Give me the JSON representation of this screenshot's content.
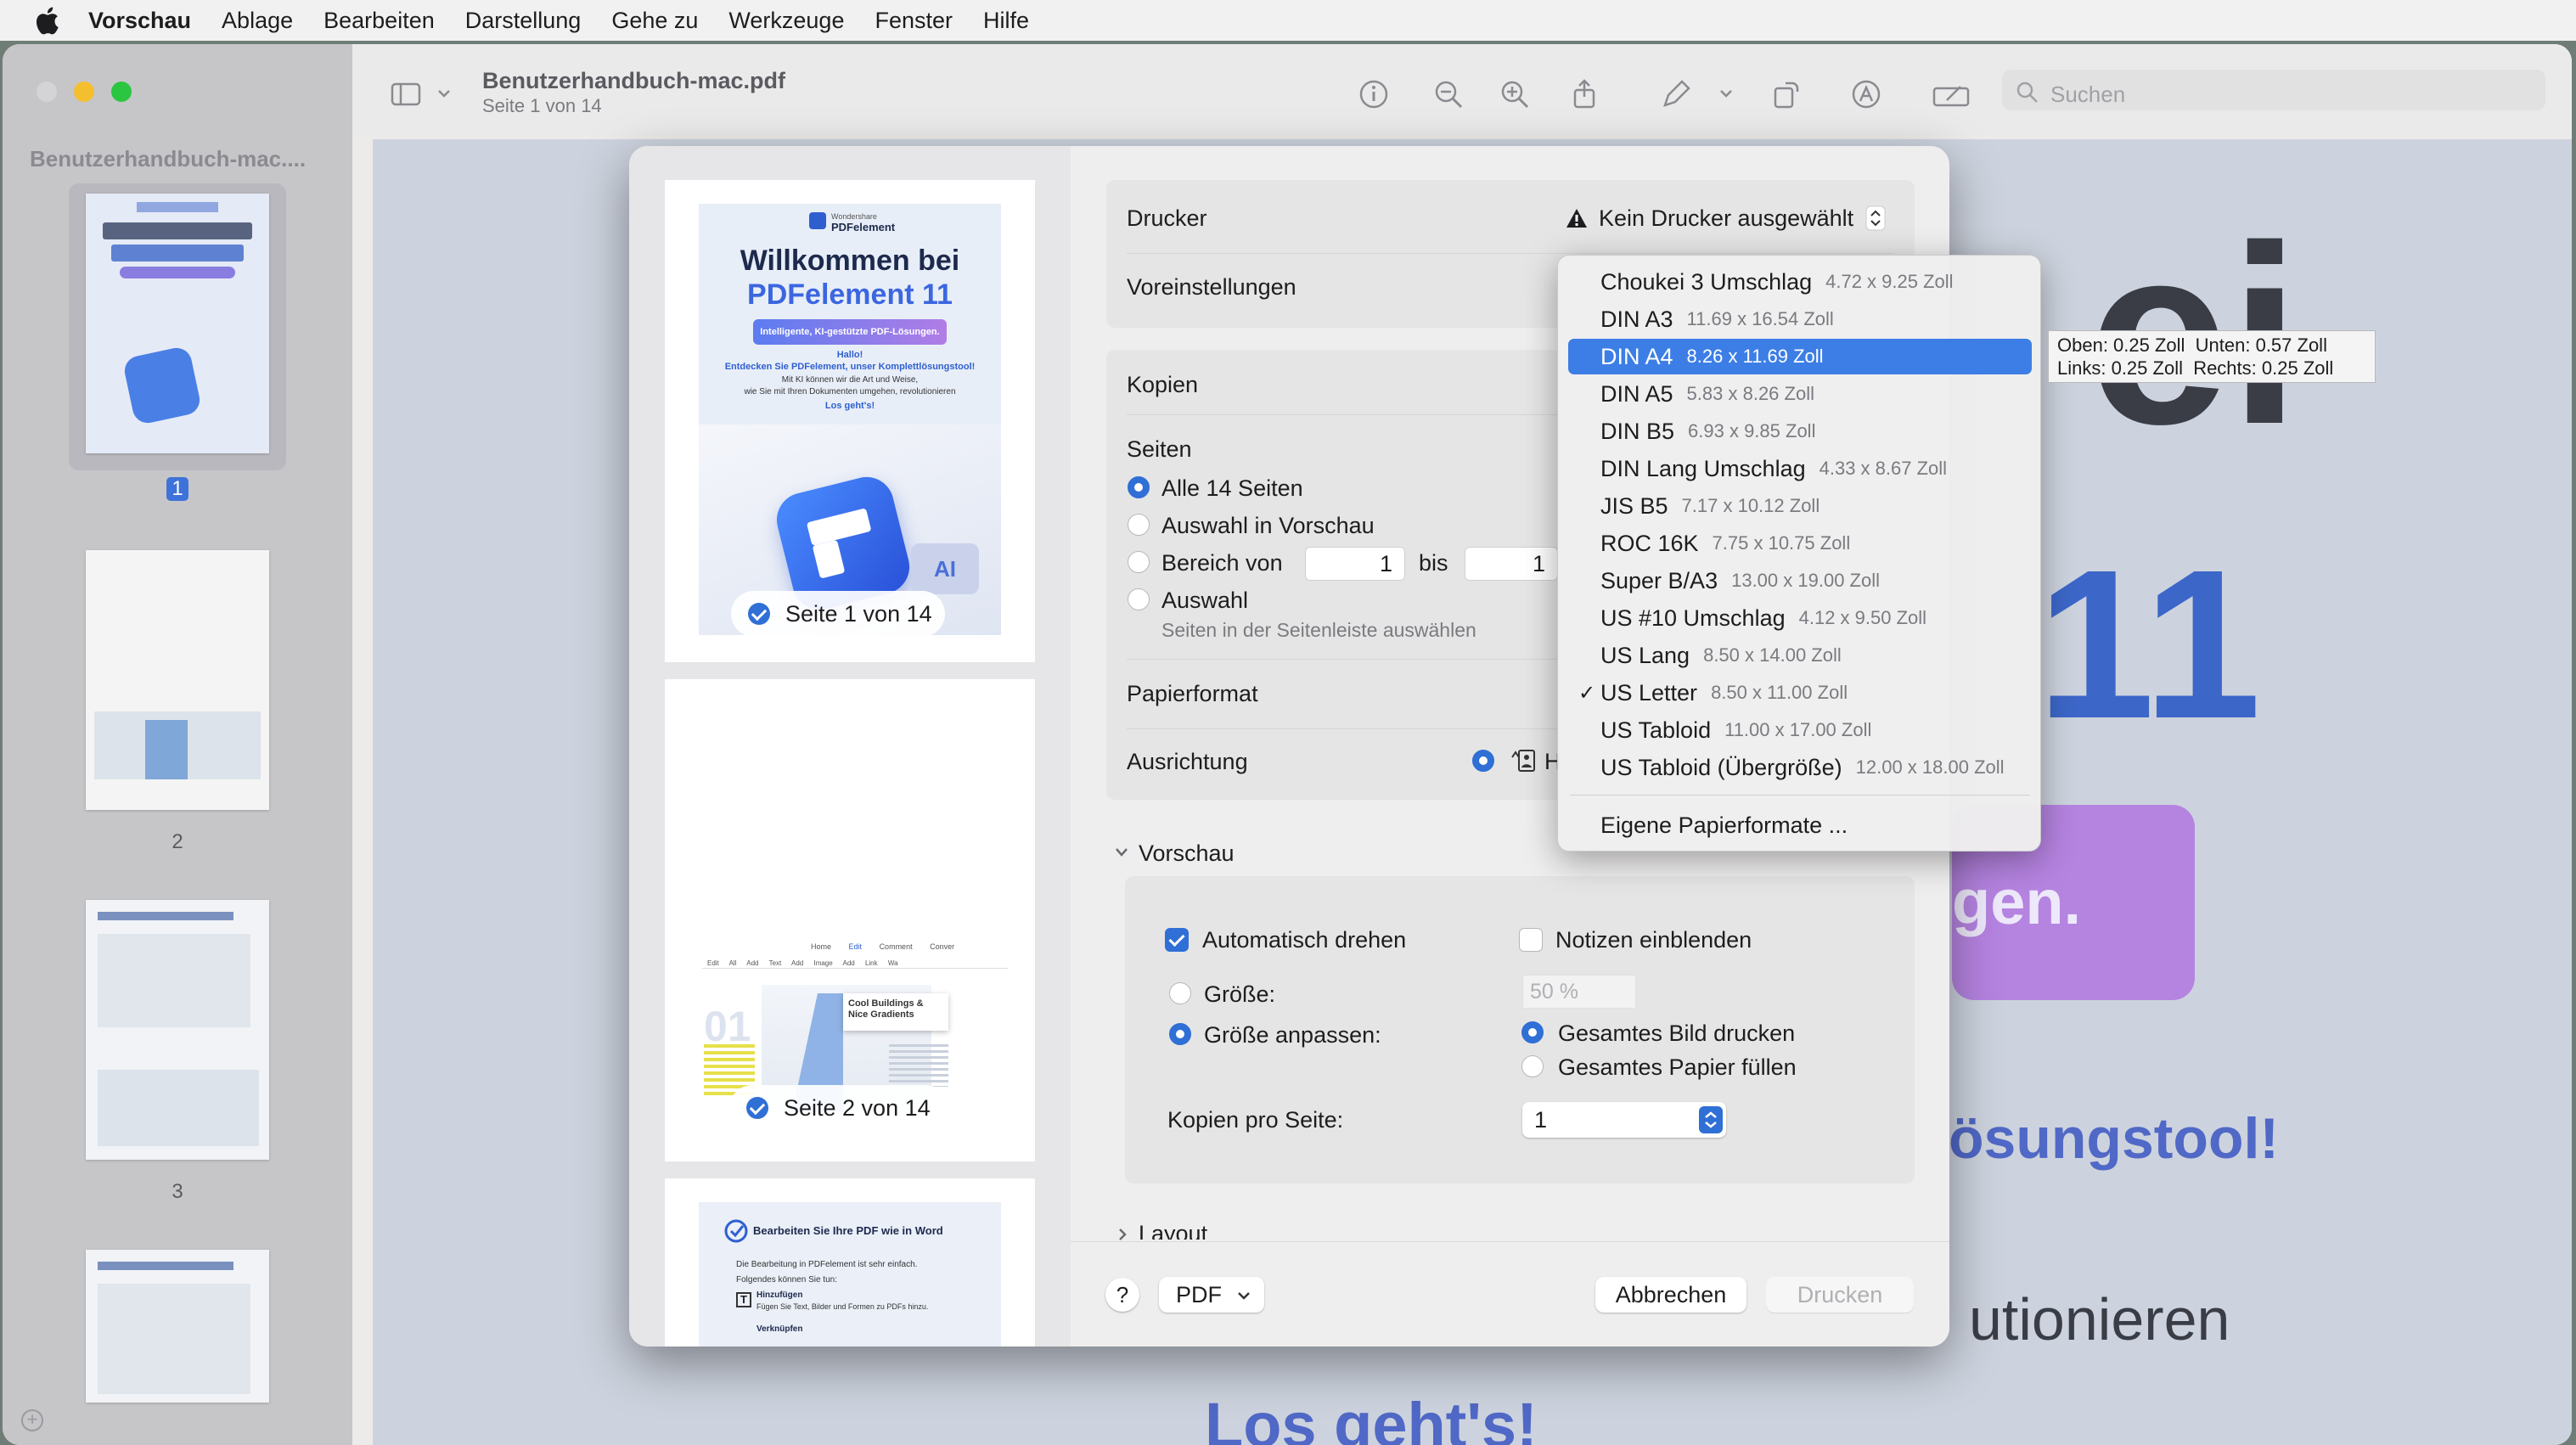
{
  "menubar": {
    "apple": "apple-icon",
    "items": [
      "Vorschau",
      "Ablage",
      "Bearbeiten",
      "Darstellung",
      "Gehe zu",
      "Werkzeuge",
      "Fenster",
      "Hilfe"
    ]
  },
  "window": {
    "title": "Benutzerhandbuch-mac.pdf",
    "subtitle": "Seite 1 von 14",
    "search_placeholder": "Suchen",
    "sidebar_title": "Benutzerhandbuch-mac....",
    "sidebar_pages": [
      "1",
      "2",
      "3"
    ]
  },
  "document": {
    "fragments": [
      "ei",
      "11",
      "gen.",
      "ösungstool!",
      "utionieren",
      "Los geht's!"
    ]
  },
  "preview_pages": {
    "page1": {
      "brand_small": "Wondershare",
      "brand": "PDFelement",
      "heading1": "Willkommen bei",
      "heading2": "PDFelement 11",
      "pill": "Intelligente, KI-gestützte PDF-Lösungen.",
      "hello": "Hallo!",
      "intro": "Entdecken Sie PDFelement, unser Komplettlösungstool!",
      "body1": "Mit KI können wir die Art und Weise,",
      "body2": "wie Sie mit Ihren Dokumenten umgehen, revolutionieren",
      "cta": "Los geht's!",
      "ai": "AI",
      "badge": "Seite 1 von 14"
    },
    "page2": {
      "tabs": [
        "Home",
        "Edit",
        "Comment",
        "Conver"
      ],
      "tools": [
        "Edit All",
        "Add Text",
        "Add Image",
        "Add Link",
        "Wa"
      ],
      "number": "01",
      "card": "Cool Buildings & Nice Gradients",
      "badge": "Seite 2 von 14"
    },
    "page3": {
      "title": "Bearbeiten Sie Ihre PDF wie in Word",
      "line1": "Die Bearbeitung in PDFelement ist sehr einfach.",
      "line2": "Folgendes können Sie tun:",
      "h1": "Hinzufügen",
      "h1_text": "Fügen Sie Text, Bilder und Formen zu PDFs hinzu.",
      "h2": "Verknüpfen"
    }
  },
  "print": {
    "printer_label": "Drucker",
    "printer_value": "Kein Drucker ausgewählt",
    "presets_label": "Voreinstellungen",
    "copies_label": "Kopien",
    "pages_label": "Seiten",
    "pages_options": {
      "all": "Alle 14 Seiten",
      "selection_preview": "Auswahl in Vorschau",
      "range": "Bereich von",
      "range_to": "bis",
      "range_from_value": "1",
      "range_to_value": "1",
      "selection": "Auswahl",
      "selection_hint": "Seiten in der Seitenleiste auswählen"
    },
    "paper_label": "Papierformat",
    "orientation_label": "Ausrichtung",
    "orientation_value": "H",
    "preview_section": "Vorschau",
    "auto_rotate": "Automatisch drehen",
    "show_notes": "Notizen einblenden",
    "size_label": "Größe:",
    "size_value": "50 %",
    "scale_to_fit": "Größe anpassen:",
    "print_entire": "Gesamtes Bild drucken",
    "fill_paper": "Gesamtes Papier füllen",
    "copies_per_page_label": "Kopien pro Seite:",
    "copies_per_page_value": "1",
    "layout_section": "Layout",
    "help": "?",
    "pdf_button": "PDF",
    "cancel": "Abbrechen",
    "print": "Drucken"
  },
  "paper_menu": {
    "items": [
      {
        "name": "Choukei 3 Umschlag",
        "size": "4.72 x 9.25 Zoll"
      },
      {
        "name": "DIN A3",
        "size": "11.69 x 16.54 Zoll"
      },
      {
        "name": "DIN A4",
        "size": "8.26 x 11.69 Zoll"
      },
      {
        "name": "DIN A5",
        "size": "5.83 x 8.26 Zoll"
      },
      {
        "name": "DIN B5",
        "size": "6.93 x 9.85 Zoll"
      },
      {
        "name": "DIN Lang Umschlag",
        "size": "4.33 x 8.67 Zoll"
      },
      {
        "name": "JIS B5",
        "size": "7.17 x 10.12 Zoll"
      },
      {
        "name": "ROC 16K",
        "size": "7.75 x 10.75 Zoll"
      },
      {
        "name": "Super B/A3",
        "size": "13.00 x 19.00 Zoll"
      },
      {
        "name": "US #10 Umschlag",
        "size": "4.12 x 9.50 Zoll"
      },
      {
        "name": "US Lang",
        "size": "8.50 x 14.00 Zoll"
      },
      {
        "name": "US Letter",
        "size": "8.50 x 11.00 Zoll"
      },
      {
        "name": "US Tabloid",
        "size": "11.00 x 17.00 Zoll"
      },
      {
        "name": "US Tabloid (Übergröße)",
        "size": "12.00 x 18.00 Zoll"
      }
    ],
    "highlighted": "DIN A4",
    "checked": "US Letter",
    "custom": "Eigene Papierformate ..."
  },
  "tooltip": {
    "line1": "Oben: 0.25 Zoll  Unten: 0.57 Zoll",
    "line2": "Links: 0.25 Zoll  Rechts: 0.25 Zoll"
  },
  "colors": {
    "accent": "#2f6fd6",
    "menu_highlight": "#3c7ee6"
  }
}
